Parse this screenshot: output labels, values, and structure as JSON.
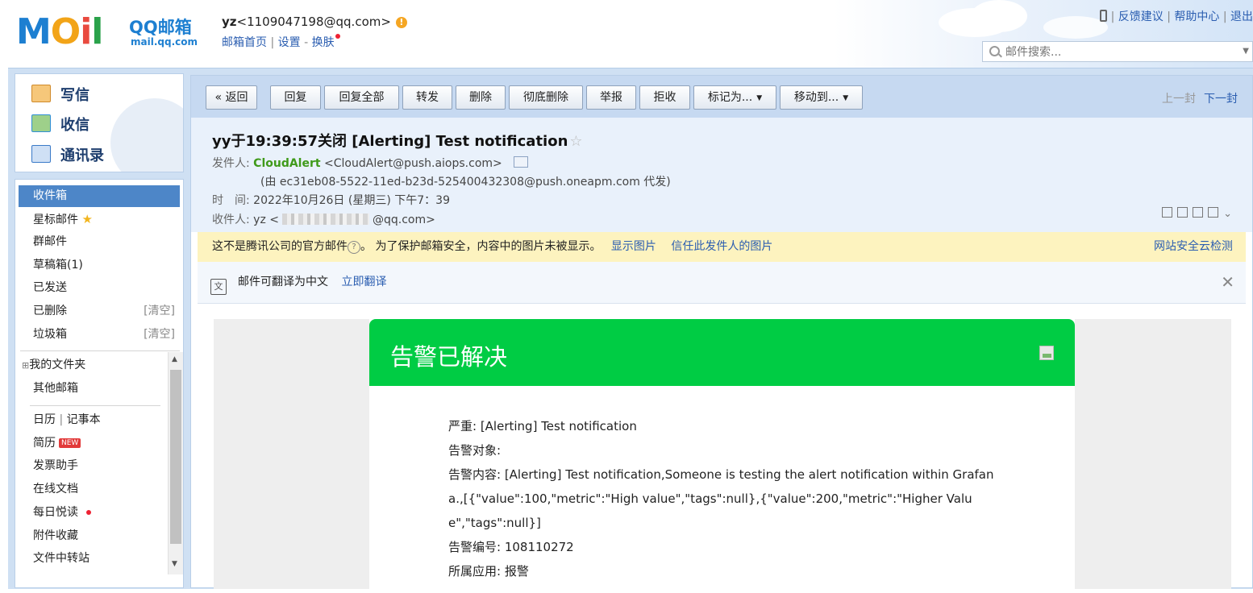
{
  "brand": {
    "logo_text": "MOil",
    "product_name": "QQ邮箱",
    "domain": "mail.qq.com"
  },
  "header": {
    "user_name": "yz",
    "user_email": "<1109047198@qq.com>",
    "alert_icon": "exclamation-icon",
    "links": {
      "home": "邮箱首页",
      "settings": "设置",
      "skin": "换肤"
    },
    "top_links": {
      "feedback": "反馈建议",
      "help": "帮助中心",
      "logout": "退出"
    },
    "search_placeholder": "邮件搜索..."
  },
  "sidebar": {
    "quick": [
      {
        "label": "写信",
        "icon": "compose-icon",
        "color": "#e07b2a"
      },
      {
        "label": "收信",
        "icon": "inbox-download-icon",
        "color": "#2f8fd6"
      },
      {
        "label": "通讯录",
        "icon": "contacts-icon",
        "color": "#3a7ac8"
      }
    ],
    "folders": {
      "inbox": "收件箱",
      "starred": "星标邮件",
      "group": "群邮件",
      "drafts": "草稿箱(1)",
      "sent": "已发送",
      "deleted": "已删除",
      "spam": "垃圾箱",
      "clear": "[清空]",
      "my_folders": "我的文件夹",
      "other_mailboxes": "其他邮箱",
      "calendar": "日历",
      "notes": "记事本",
      "resume": "简历",
      "new_badge": "NEW",
      "invoice": "发票助手",
      "online_docs": "在线文档",
      "daily_reading": "每日悦读",
      "attachments": "附件收藏",
      "file_transfer": "文件中转站"
    }
  },
  "toolbar": {
    "back": "« 返回",
    "reply": "回复",
    "reply_all": "回复全部",
    "forward": "转发",
    "delete": "删除",
    "delete_permanent": "彻底删除",
    "report": "举报",
    "reject": "拒收",
    "mark_as": "标记为...",
    "move_to": "移动到...",
    "prev": "上一封",
    "next": "下一封"
  },
  "message": {
    "subject": "yy于19:39:57关闭 [Alerting] Test notification",
    "sender_label": "发件人:",
    "sender_name": "CloudAlert",
    "sender_email": "<CloudAlert@push.aiops.com>",
    "sent_via": "(由 ec31eb08-5522-11ed-b23d-525400432308@push.oneapm.com 代发)",
    "time_label": "时　间:",
    "time": "2022年10月26日 (星期三) 下午7：39",
    "to_label": "收件人:",
    "to_name": "yz",
    "to_email_tail": "@qq.com>",
    "to_email_head": "<"
  },
  "notice": {
    "text1": "这不是腾讯公司的官方邮件",
    "text2": "。 为了保护邮箱安全，内容中的图片未被显示。",
    "show_images": "显示图片",
    "trust_sender": "信任此发件人的图片",
    "security_check": "网站安全云检测"
  },
  "translate": {
    "text": "邮件可翻译为中文",
    "action": "立即翻译"
  },
  "email_body": {
    "banner_title": "告警已解决",
    "banner_color": "#00cc44",
    "lines": [
      "严重: [Alerting] Test notification",
      "告警对象:",
      "告警内容: [Alerting] Test notification,Someone is testing the alert notification within Grafana.,[{\"value\":100,\"metric\":\"High value\",\"tags\":null},{\"value\":200,\"metric\":\"Higher Value\",\"tags\":null}]",
      "告警编号: 108110272",
      "所属应用: 报警"
    ]
  }
}
